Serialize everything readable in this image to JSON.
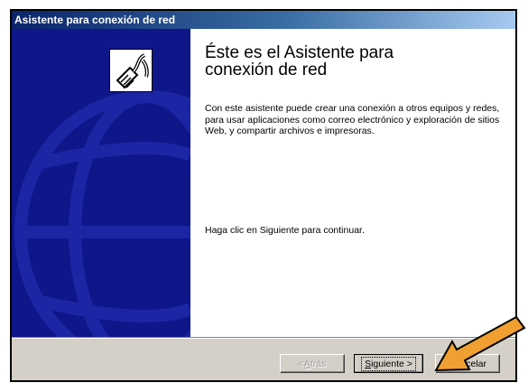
{
  "window": {
    "title": "Asistente para conexión de red"
  },
  "content": {
    "heading_line1": "Éste es el Asistente para",
    "heading_line2": "conexión de red",
    "intro": "Con este asistente puede crear una conexión a otros equipos y redes, para usar aplicaciones como correo electrónico y exploración de sitios Web, y compartir archivos e impresoras.",
    "next_hint": "Haga clic en Siguiente para continuar."
  },
  "buttons": {
    "back_prefix": "< ",
    "back_key": "A",
    "back_rest": "trás",
    "next_key": "S",
    "next_rest": "iguiente >",
    "cancel": "Cancelar"
  },
  "colors": {
    "side_panel": "#0f168a",
    "arrow": "#f0a030"
  },
  "icons": {
    "wizard": "network-cable-icon",
    "annotation": "orange-arrow-icon"
  }
}
